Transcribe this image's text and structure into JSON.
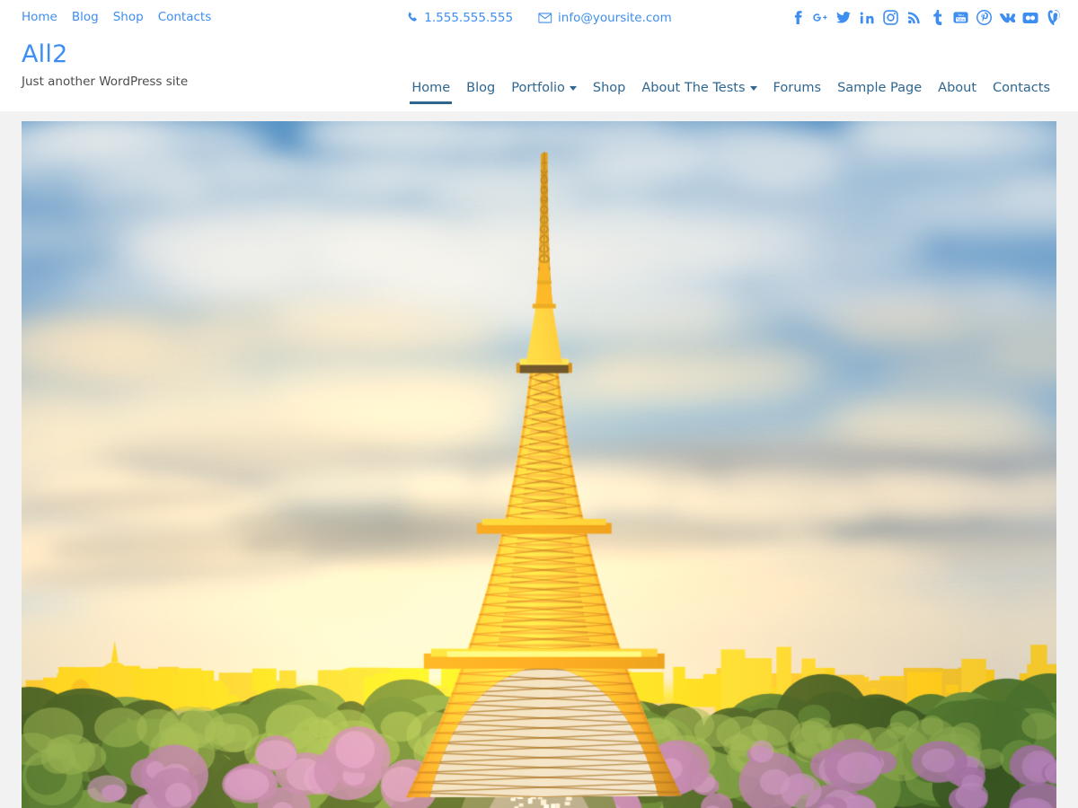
{
  "top_bar": {
    "links": [
      {
        "label": "Home",
        "name": "topbar-link-home"
      },
      {
        "label": "Blog",
        "name": "topbar-link-blog"
      },
      {
        "label": "Shop",
        "name": "topbar-link-shop"
      },
      {
        "label": "Contacts",
        "name": "topbar-link-contacts"
      }
    ],
    "phone": "1.555.555.555",
    "email": "info@yoursite.com",
    "phone_icon": "phone-icon",
    "email_icon": "envelope-icon",
    "social": [
      {
        "name": "facebook-icon",
        "label": "Facebook"
      },
      {
        "name": "google-plus-icon",
        "label": "Google Plus"
      },
      {
        "name": "twitter-icon",
        "label": "Twitter"
      },
      {
        "name": "linkedin-icon",
        "label": "LinkedIn"
      },
      {
        "name": "instagram-icon",
        "label": "Instagram"
      },
      {
        "name": "rss-icon",
        "label": "RSS"
      },
      {
        "name": "tumblr-icon",
        "label": "Tumblr"
      },
      {
        "name": "youtube-icon",
        "label": "YouTube"
      },
      {
        "name": "pinterest-icon",
        "label": "Pinterest"
      },
      {
        "name": "vk-icon",
        "label": "VK"
      },
      {
        "name": "flickr-icon",
        "label": "Flickr"
      },
      {
        "name": "vine-icon",
        "label": "Vine"
      }
    ]
  },
  "branding": {
    "title": "All2",
    "tagline": "Just another WordPress site"
  },
  "main_nav": {
    "items": [
      {
        "label": "Home",
        "active": true,
        "caret": false,
        "name": "nav-item-home"
      },
      {
        "label": "Blog",
        "active": false,
        "caret": false,
        "name": "nav-item-blog"
      },
      {
        "label": "Portfolio",
        "active": false,
        "caret": true,
        "name": "nav-item-portfolio"
      },
      {
        "label": "Shop",
        "active": false,
        "caret": false,
        "name": "nav-item-shop"
      },
      {
        "label": "About The Tests",
        "active": false,
        "caret": true,
        "name": "nav-item-about-the-tests"
      },
      {
        "label": "Forums",
        "active": false,
        "caret": false,
        "name": "nav-item-forums"
      },
      {
        "label": "Sample Page",
        "active": false,
        "caret": false,
        "name": "nav-item-sample-page"
      },
      {
        "label": "About",
        "active": false,
        "caret": false,
        "name": "nav-item-about"
      },
      {
        "label": "Contacts",
        "active": false,
        "caret": false,
        "name": "nav-item-contacts"
      }
    ]
  },
  "hero": {
    "alt": "Eiffel Tower at sunset over Paris",
    "colors": {
      "sky_top": "#4e92cf",
      "sky_mid": "#8fb8dc",
      "cloud_warm": "#f2e2c8",
      "cloud_shadow": "#8d97a6",
      "tower_gold": "#e8a020",
      "tower_bright": "#ffc93f",
      "tower_dark": "#a05f14",
      "city_gold": "#f5c518",
      "foliage": "#3c6b2a",
      "foliage_dark": "#22401a",
      "blossom": "#9b6aa8"
    }
  },
  "theme": {
    "accent_blue": "#3d8ef0",
    "nav_blue": "#2f6690",
    "page_bg": "#f2f2f2",
    "header_bg": "#ffffff"
  }
}
